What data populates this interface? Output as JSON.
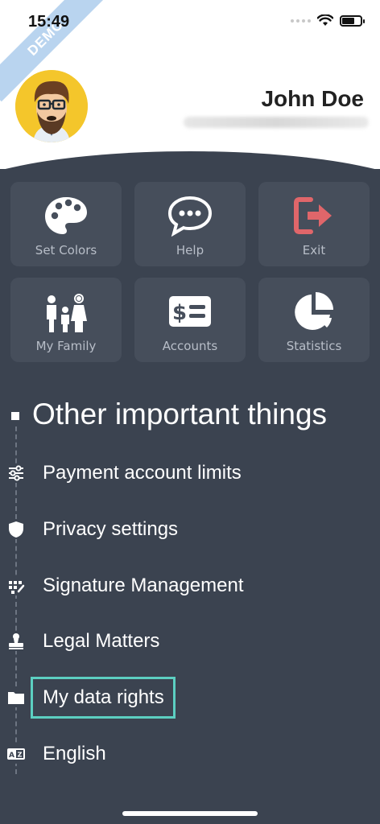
{
  "status": {
    "time": "15:49"
  },
  "ribbon": {
    "text": "DEMO"
  },
  "profile": {
    "name": "John Doe"
  },
  "tiles": [
    {
      "label": "Set Colors",
      "icon": "palette-icon"
    },
    {
      "label": "Help",
      "icon": "chat-bubble-icon"
    },
    {
      "label": "Exit",
      "icon": "exit-icon"
    },
    {
      "label": "My Family",
      "icon": "family-icon"
    },
    {
      "label": "Accounts",
      "icon": "money-card-icon"
    },
    {
      "label": "Statistics",
      "icon": "pie-chart-icon"
    }
  ],
  "section": {
    "title": "Other important things"
  },
  "menu": [
    {
      "label": "Payment account limits",
      "icon": "sliders-icon"
    },
    {
      "label": "Privacy settings",
      "icon": "shield-icon"
    },
    {
      "label": "Signature Management",
      "icon": "signature-icon"
    },
    {
      "label": "Legal Matters",
      "icon": "stamp-icon"
    },
    {
      "label": "My data rights",
      "icon": "folder-icon"
    },
    {
      "label": "English",
      "icon": "language-icon"
    }
  ],
  "colors": {
    "background": "#3b4350",
    "tile": "#464e5b",
    "exit_accent": "#e0666a",
    "highlight": "#5ccfc1"
  }
}
